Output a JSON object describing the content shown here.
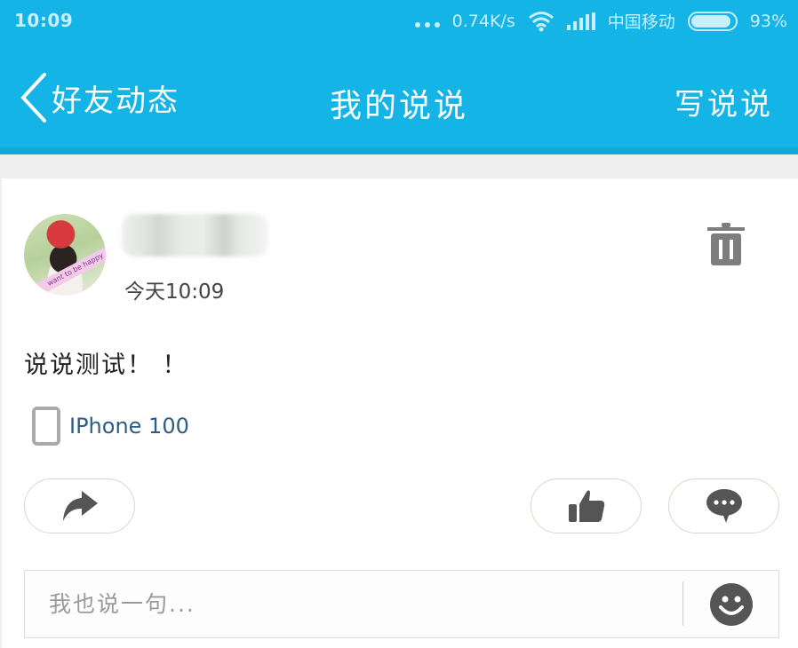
{
  "status_bar": {
    "time": "10:09",
    "network_speed": "0.74K/s",
    "carrier": "中国移动",
    "battery_level": "93%",
    "battery_fraction": 0.93,
    "icons": [
      "more-dots-icon",
      "wifi-icon",
      "signal-icon",
      "battery-icon"
    ]
  },
  "navbar": {
    "back_label": "好友动态",
    "title": "我的说说",
    "action_label": "写说说"
  },
  "post": {
    "username": "",
    "timestamp": "今天10:09",
    "avatar_caption": "want to be happy",
    "content": "说说测试！ ！",
    "device_label": "IPhone 100"
  },
  "actions": {
    "share": "share-icon",
    "like": "thumbs-up-icon",
    "comment": "comment-bubble-icon"
  },
  "comment_box": {
    "placeholder": "我也说一句...",
    "value": ""
  },
  "colors": {
    "brand": "#14b4e6",
    "device_link": "#2d5d82",
    "icon_gray": "#555555"
  }
}
